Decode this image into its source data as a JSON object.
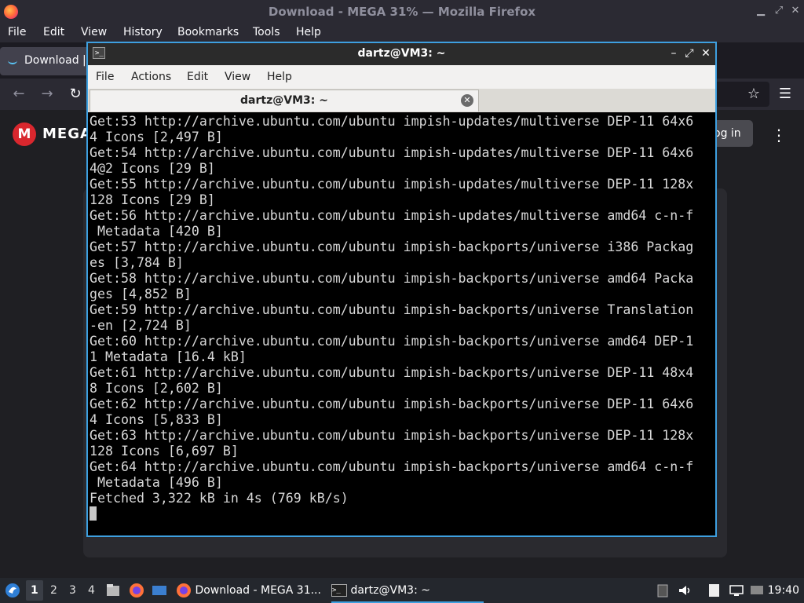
{
  "firefox": {
    "window_title": "Download - MEGA 31% — Mozilla Firefox",
    "menu": [
      "File",
      "Edit",
      "View",
      "History",
      "Bookmarks",
      "Tools",
      "Help"
    ],
    "tab_label": "Download |",
    "page": {
      "brand": "MEGA",
      "login_label": "og in"
    }
  },
  "terminal": {
    "title": "dartz@VM3: ~",
    "menu": [
      "File",
      "Actions",
      "Edit",
      "View",
      "Help"
    ],
    "tab_label": "dartz@VM3: ~",
    "lines": [
      "Get:53 http://archive.ubuntu.com/ubuntu impish-updates/multiverse DEP-11 64x6",
      "4 Icons [2,497 B]",
      "Get:54 http://archive.ubuntu.com/ubuntu impish-updates/multiverse DEP-11 64x6",
      "4@2 Icons [29 B]",
      "Get:55 http://archive.ubuntu.com/ubuntu impish-updates/multiverse DEP-11 128x",
      "128 Icons [29 B]",
      "Get:56 http://archive.ubuntu.com/ubuntu impish-updates/multiverse amd64 c-n-f",
      " Metadata [420 B]",
      "Get:57 http://archive.ubuntu.com/ubuntu impish-backports/universe i386 Packag",
      "es [3,784 B]",
      "Get:58 http://archive.ubuntu.com/ubuntu impish-backports/universe amd64 Packa",
      "ges [4,852 B]",
      "Get:59 http://archive.ubuntu.com/ubuntu impish-backports/universe Translation",
      "-en [2,724 B]",
      "Get:60 http://archive.ubuntu.com/ubuntu impish-backports/universe amd64 DEP-1",
      "1 Metadata [16.4 kB]",
      "Get:61 http://archive.ubuntu.com/ubuntu impish-backports/universe DEP-11 48x4",
      "8 Icons [2,602 B]",
      "Get:62 http://archive.ubuntu.com/ubuntu impish-backports/universe DEP-11 64x6",
      "4 Icons [5,833 B]",
      "Get:63 http://archive.ubuntu.com/ubuntu impish-backports/universe DEP-11 128x",
      "128 Icons [6,697 B]",
      "Get:64 http://archive.ubuntu.com/ubuntu impish-backports/universe amd64 c-n-f",
      " Metadata [496 B]",
      "Fetched 3,322 kB in 4s (769 kB/s)"
    ]
  },
  "taskbar": {
    "workspaces": [
      "1",
      "2",
      "3",
      "4"
    ],
    "tasks": [
      {
        "label": "Download - MEGA 31...",
        "icon": "firefox-icon"
      },
      {
        "label": "dartz@VM3: ~",
        "icon": "terminal-icon"
      }
    ],
    "clock": "19:40"
  }
}
